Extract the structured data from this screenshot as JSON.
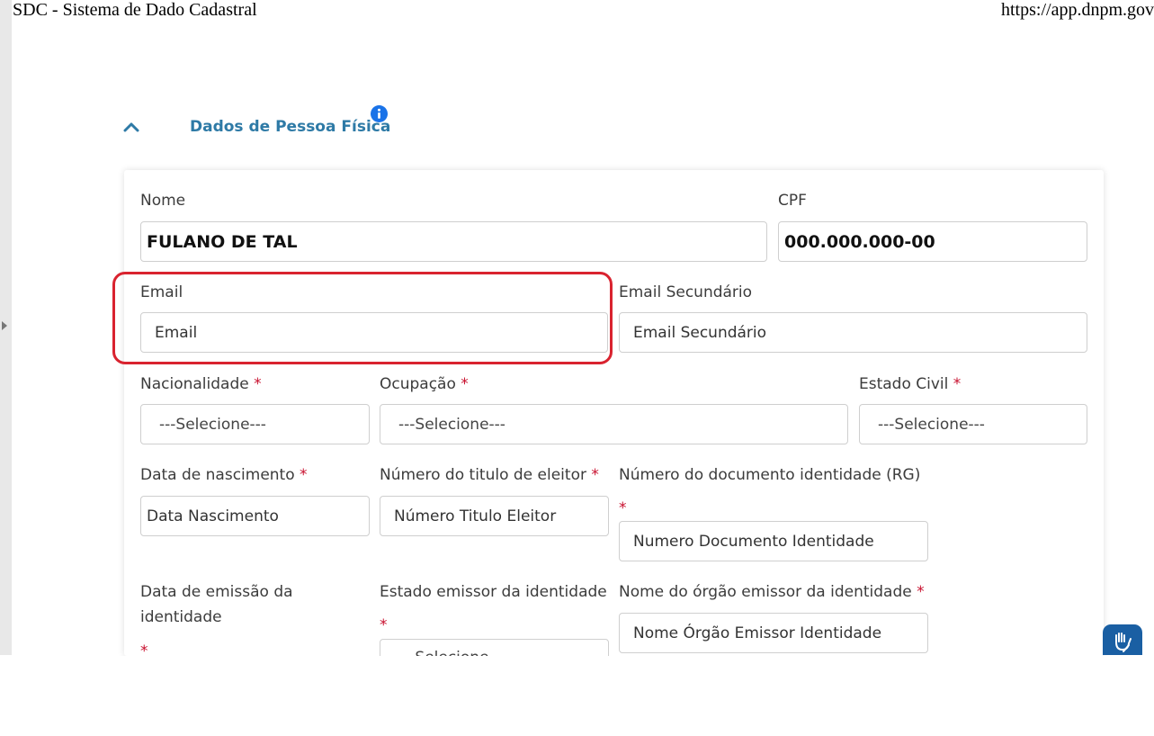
{
  "page": {
    "print_title": "SDC - Sistema de Dado Cadastral",
    "print_url": "https://app.dnpm.gov"
  },
  "section": {
    "title": "Dados de Pessoa Física",
    "toggle_icon": "chevron-up-icon",
    "info_icon": "info-icon",
    "accent_color": "#2e7aa6",
    "required_color": "#c8102e",
    "highlight_color": "#d9232f"
  },
  "form": {
    "nome": {
      "label": "Nome",
      "value": "FULANO DE TAL"
    },
    "cpf": {
      "label": "CPF",
      "value": "000.000.000-00"
    },
    "email": {
      "label": "Email",
      "placeholder": "Email"
    },
    "email_secundario": {
      "label": "Email Secundário",
      "placeholder": "Email Secundário"
    },
    "nacionalidade": {
      "label": "Nacionalidade",
      "required": "*",
      "selected": "---Selecione---"
    },
    "ocupacao": {
      "label": "Ocupação",
      "required": "*",
      "selected": "---Selecione---"
    },
    "estado_civil": {
      "label": "Estado Civil",
      "required": "*",
      "selected": "---Selecione---"
    },
    "data_nascimento": {
      "label": "Data de nascimento",
      "required": "*",
      "placeholder": "Data Nascimento"
    },
    "titulo_eleitor": {
      "label": "Número do titulo de eleitor",
      "required": "*",
      "placeholder": "Número Titulo Eleitor"
    },
    "rg": {
      "label": "Número do documento identidade (RG)",
      "required": "*",
      "placeholder": "Numero Documento Identidade"
    },
    "data_emissao": {
      "label": "Data de emissão da identidade",
      "required": "*"
    },
    "estado_emissor": {
      "label": "Estado emissor da identidade",
      "required": "*",
      "selected": "---Selecione---"
    },
    "orgao_emissor": {
      "label": "Nome do órgão emissor da identidade",
      "required": "*",
      "placeholder": "Nome Órgão Emissor Identidade"
    }
  },
  "accessibility": {
    "icon": "sign-language-icon",
    "color": "#1a5fa3"
  }
}
